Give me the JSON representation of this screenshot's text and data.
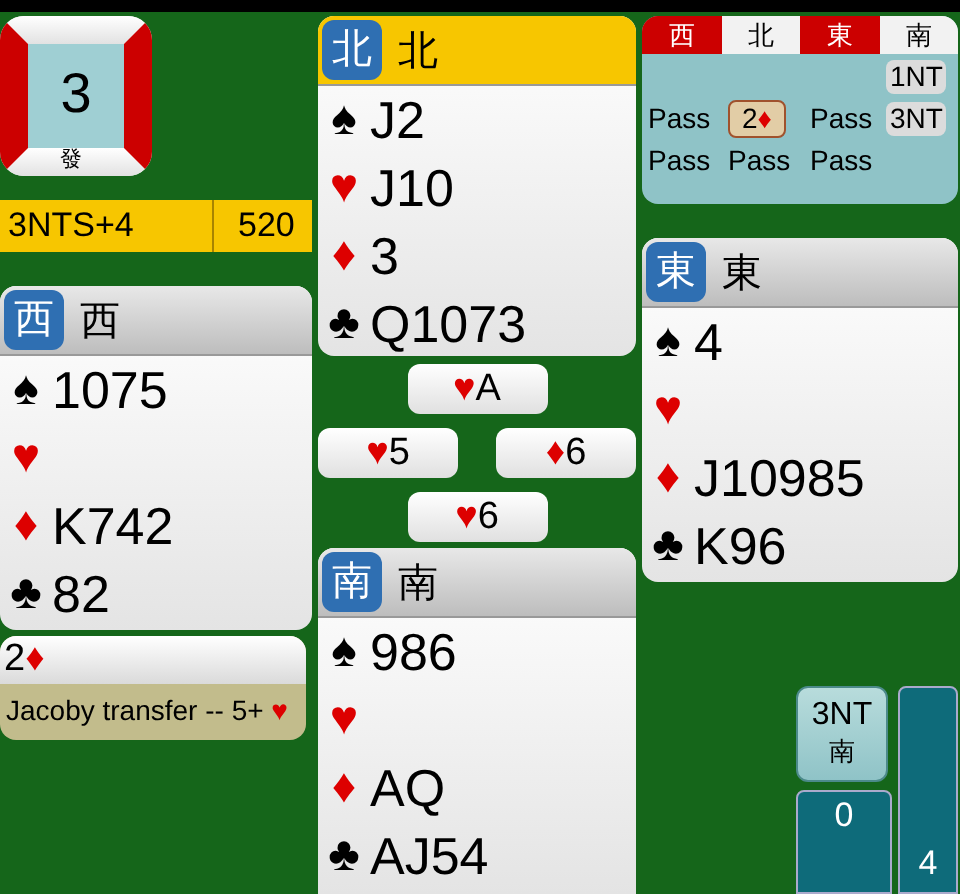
{
  "board": {
    "number": "3",
    "dealer": "發",
    "ns_vulnerable": false,
    "ew_vulnerable": true
  },
  "result": {
    "contract": "3NTS+4",
    "score": "520"
  },
  "hands": {
    "north": {
      "seat": "北",
      "name": "北",
      "active": true,
      "suits": [
        {
          "kind": "spade",
          "symbol": "♠",
          "cards": "J2"
        },
        {
          "kind": "heart",
          "symbol": "♥",
          "cards": "J10"
        },
        {
          "kind": "diamond",
          "symbol": "♦",
          "cards": "3"
        },
        {
          "kind": "club",
          "symbol": "♣",
          "cards": "Q1073"
        }
      ]
    },
    "west": {
      "seat": "西",
      "name": "西",
      "active": false,
      "suits": [
        {
          "kind": "spade",
          "symbol": "♠",
          "cards": "1075"
        },
        {
          "kind": "heart",
          "symbol": "♥"
        },
        {
          "kind": "diamond",
          "symbol": "♦",
          "cards": "K742"
        },
        {
          "kind": "club",
          "symbol": "♣",
          "cards": "82"
        }
      ]
    },
    "east": {
      "seat": "東",
      "name": "東",
      "active": false,
      "suits": [
        {
          "kind": "spade",
          "symbol": "♠",
          "cards": "4"
        },
        {
          "kind": "heart",
          "symbol": "♥"
        },
        {
          "kind": "diamond",
          "symbol": "♦",
          "cards": "J10985"
        },
        {
          "kind": "club",
          "symbol": "♣",
          "cards": "K96"
        }
      ]
    },
    "south": {
      "seat": "南",
      "name": "南",
      "active": false,
      "suits": [
        {
          "kind": "spade",
          "symbol": "♠",
          "cards": "986"
        },
        {
          "kind": "heart",
          "symbol": "♥"
        },
        {
          "kind": "diamond",
          "symbol": "♦",
          "cards": "AQ"
        },
        {
          "kind": "club",
          "symbol": "♣",
          "cards": "AJ54"
        }
      ]
    }
  },
  "trick": {
    "north": {
      "kind": "heart",
      "symbol": "♥",
      "rank": "A"
    },
    "west": {
      "kind": "heart",
      "symbol": "♥",
      "rank": "5"
    },
    "east": {
      "kind": "diamond",
      "symbol": "♦",
      "rank": "6"
    },
    "south": {
      "kind": "heart",
      "symbol": "♥",
      "rank": "6"
    }
  },
  "bidding": {
    "headers": [
      {
        "label": "西",
        "vulnerable": true
      },
      {
        "label": "北",
        "vulnerable": false
      },
      {
        "label": "東",
        "vulnerable": true
      },
      {
        "label": "南",
        "vulnerable": false
      }
    ],
    "rows": [
      [
        null,
        null,
        null,
        {
          "kind": "highlight",
          "text": "1NT"
        }
      ],
      [
        {
          "kind": "plain",
          "text": "Pass"
        },
        {
          "kind": "alert",
          "text": "2",
          "symbol": "♦",
          "symbol_red": true
        },
        {
          "kind": "plain",
          "text": "Pass"
        },
        {
          "kind": "highlight",
          "text": "3NT"
        }
      ],
      [
        {
          "kind": "plain",
          "text": "Pass"
        },
        {
          "kind": "plain",
          "text": "Pass"
        },
        {
          "kind": "plain",
          "text": "Pass"
        },
        null
      ]
    ]
  },
  "explanation": {
    "bid": "2",
    "bid_symbol": "♦",
    "bid_symbol_red": true,
    "text": "Jacoby transfer -- 5+",
    "text_symbol": "♥",
    "text_symbol_red": true
  },
  "status": {
    "contract": "3NT",
    "declarer": "南",
    "counter_1": "0",
    "counter_2": "4"
  }
}
